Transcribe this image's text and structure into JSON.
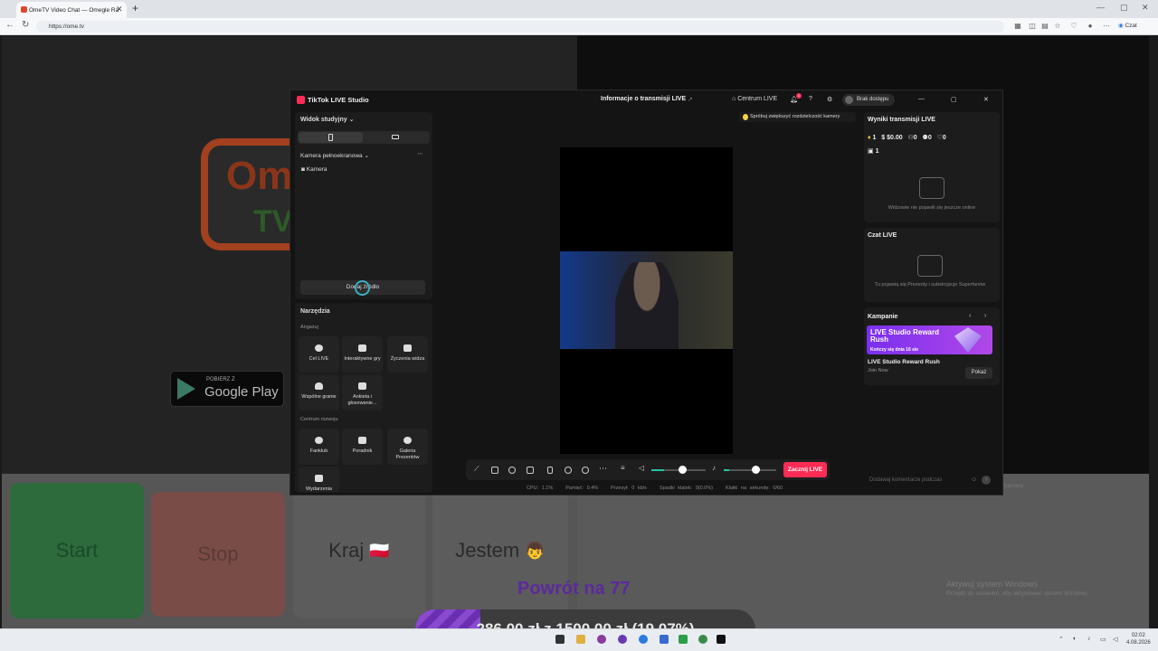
{
  "browser": {
    "tab_title": "OmeTV Video Chat — Omegle Ra",
    "tab_close": "✕",
    "new_tab": "+",
    "url": "https://ome.tv",
    "profile_label": "Czat",
    "window_controls": [
      "—",
      "▢",
      "✕"
    ]
  },
  "site": {
    "logo_main": "Ome",
    "logo_tv": "TV",
    "gplay_small": "POBIERZ Z",
    "gplay_large": "Google Play",
    "buttons": {
      "start": "Start",
      "stop": "Stop",
      "kraj": "Kraj",
      "jestem": "Jestem"
    },
    "kraj_flag": "🇵🇱",
    "jestem_emoji": "👦",
    "win_activate_title": "Aktywuj system Windows",
    "win_activate_sub": "Przejdź do ustawień, aby aktywować system Windows.",
    "chat_hint": "kamery"
  },
  "overlay": {
    "powrot": "Powrót na 77",
    "progress_text": "286,00 zł z 1500,00 zł (19.07%)",
    "progress_fraction": 0.1907
  },
  "tiktok": {
    "app_title": "TikTok LIVE Studio",
    "center_title": "Informacje o transmisji LIVE",
    "centrum": "Centrum LIVE",
    "notif_count": "1",
    "access": "Brak dostępu",
    "studio_view": "Widok studyjny",
    "camera_full": "Kamera pełnoekranowa",
    "camera": "Kamera",
    "add_source": "Dodaj źródło",
    "tools": "Narzędzia",
    "engage": "Angażuj",
    "tools_items": [
      "Cel LIVE",
      "Interaktywne gry",
      "Życzenia widza",
      "Wspólne granie",
      "Ankieta i głosowanie..."
    ],
    "growth": "Centrum rozwoju",
    "growth_items": [
      "Fanklub",
      "Poradnik",
      "Galeria Prezentów",
      "Wydarzenia"
    ],
    "hint": "Spróbuj zwiększyć rozdzielczość kamery",
    "go_live": "Zacznij LIVE",
    "stats": [
      "CPU: 1.1%",
      "Pamięć: 0.4%",
      "Przesył: 0 kb/s",
      "Spadki klatek: 0(0.0%)",
      "Klatki na sekundę: 0/60"
    ],
    "results_title": "Wyniki transmisji LIVE",
    "results_metrics": [
      "1",
      "$0.00",
      "0",
      "0",
      "0"
    ],
    "results_second": "1",
    "no_viewers": "Widzowie nie pojawili się jeszcze online",
    "chat_title": "Czat LIVE",
    "chat_empty": "Tu pojawią się Prezenty i subskrypcje Superfanów",
    "campaigns": "Kampanie",
    "banner_title": "LIVE Studio Reward Rush",
    "banner_sub": "Kończy się dnia 16 sie",
    "campaign_name": "LIVE Studio Reward Rush",
    "campaign_join": "Join Now",
    "show": "Pokaż",
    "comment_placeholder": "Dodawaj komentarze podczas"
  },
  "taskbar": {
    "time": "02:02",
    "date": "4.08.2026"
  }
}
